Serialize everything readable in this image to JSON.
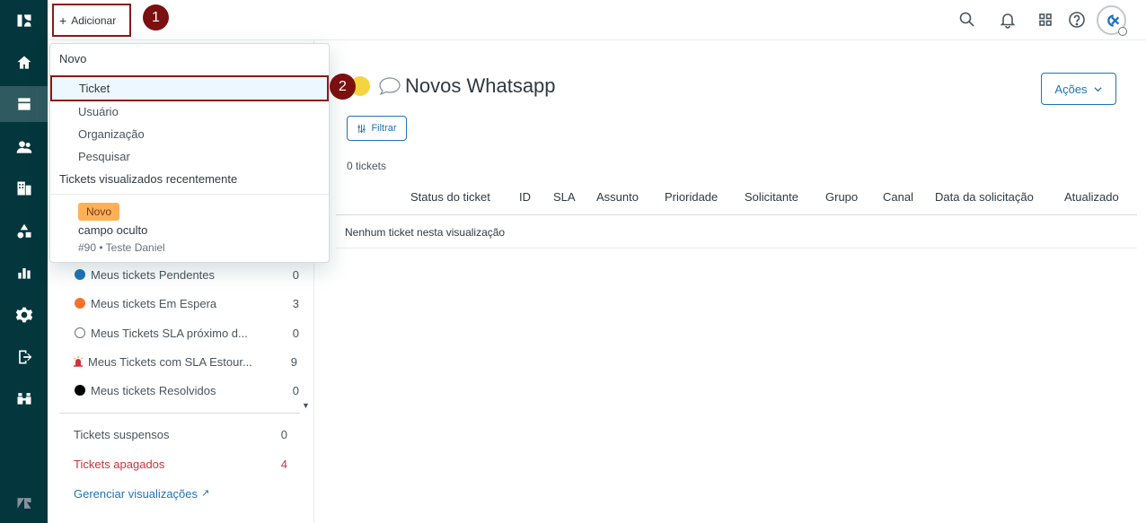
{
  "topbar": {
    "add_label": "Adicionar",
    "add_plus": "+",
    "step1": "1"
  },
  "dropdown": {
    "section_new": "Novo",
    "items": [
      "Ticket",
      "Usuário",
      "Organização",
      "Pesquisar"
    ],
    "step2": "2",
    "section_recent": "Tickets visualizados recentemente",
    "recent": {
      "tag": "Novo",
      "title": "campo oculto",
      "subtitle": "#90 • Teste Daniel"
    }
  },
  "views": {
    "items": [
      {
        "label": "Meus tickets Pendentes",
        "count": "0",
        "color": "#1f73b7",
        "icon": "circle"
      },
      {
        "label": "Meus tickets Em Espera",
        "count": "3",
        "color": "#f7712b",
        "icon": "circle"
      },
      {
        "label": "Meus Tickets SLA próximo d...",
        "count": "0",
        "color": "#68737d",
        "icon": "timer-icon"
      },
      {
        "label": "Meus Tickets com SLA Estour...",
        "count": "9",
        "color": "#cc3340",
        "icon": "alarm-icon"
      },
      {
        "label": "Meus tickets Resolvidos",
        "count": "0",
        "color": "#000000",
        "icon": "circle"
      }
    ],
    "suspended": {
      "label": "Tickets suspensos",
      "count": "0"
    },
    "deleted": {
      "label": "Tickets apagados",
      "count": "4"
    },
    "manage": {
      "label": "Gerenciar visualizações"
    }
  },
  "main": {
    "title": "Novos Whatsapp",
    "actions_label": "Ações",
    "filter_label": "Filtrar",
    "ticket_count": "0 tickets",
    "columns": [
      "Status do ticket",
      "ID",
      "SLA",
      "Assunto",
      "Prioridade",
      "Solicitante",
      "Grupo",
      "Canal",
      "Data da solicitação",
      "Atualizado"
    ],
    "empty_message": "Nenhum ticket nesta visualização"
  },
  "colors": {
    "nav_bg": "#03363d",
    "accent": "#1f73b7",
    "highlight_border": "#8b1a1a",
    "badge": "#7a1010",
    "deleted_text": "#cc3340"
  }
}
